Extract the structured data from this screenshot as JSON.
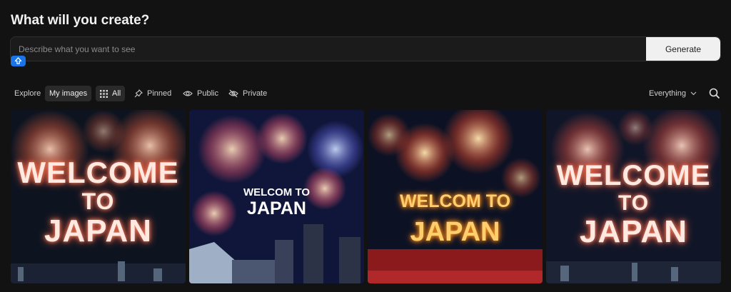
{
  "header": {
    "title": "What will you create?"
  },
  "prompt": {
    "placeholder": "Describe what you want to see",
    "value": "",
    "generate_label": "Generate"
  },
  "filters": {
    "explore": "Explore",
    "my_images": "My images",
    "all": "All",
    "pinned": "Pinned",
    "public": "Public",
    "private": "Private",
    "sort_label": "Everything"
  },
  "gallery": {
    "images": [
      {
        "line1": "WELCOME",
        "line2": "TO",
        "line3": "JAPAN"
      },
      {
        "line1": "WELCOM TO",
        "line2": "JAPAN"
      },
      {
        "line1": "WELCOM TO",
        "line2": "JAPAN"
      },
      {
        "line1": "WELCOME",
        "line2": "TO",
        "line3": "JAPAN"
      }
    ]
  },
  "colors": {
    "accent": "#1a74e8",
    "background": "#121212",
    "button_bg": "#f0f0f0"
  }
}
